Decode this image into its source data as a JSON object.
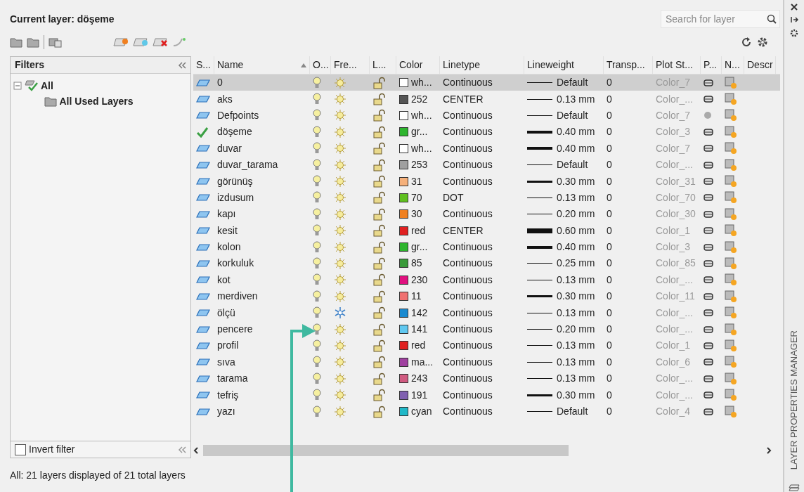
{
  "header": {
    "title": "Current layer: döşeme",
    "search": {
      "placeholder": "Search for layer"
    }
  },
  "filters": {
    "title": "Filters",
    "tree": [
      {
        "label": "All",
        "expanded": true,
        "children": [
          {
            "label": "All Used Layers"
          }
        ]
      }
    ],
    "invert_filter": {
      "label": "Invert filter",
      "checked": false
    }
  },
  "table": {
    "columns": [
      {
        "label": "S...",
        "sorted": false
      },
      {
        "label": "Name",
        "sorted": true
      },
      {
        "label": "O...",
        "sorted": false
      },
      {
        "label": "Fre...",
        "sorted": false
      },
      {
        "label": "L...",
        "sorted": false
      },
      {
        "label": "Color",
        "sorted": false
      },
      {
        "label": "Linetype",
        "sorted": false
      },
      {
        "label": "Lineweight",
        "sorted": false
      },
      {
        "label": "Transp...",
        "sorted": false
      },
      {
        "label": "Plot St...",
        "sorted": false
      },
      {
        "label": "P...",
        "sorted": false
      },
      {
        "label": "N...",
        "sorted": false
      },
      {
        "label": "Descr",
        "sorted": false
      }
    ],
    "rows": [
      {
        "kind": "layer",
        "name": "0",
        "on": true,
        "frozen": false,
        "locked": false,
        "color": "#ffffff",
        "color_label": "wh...",
        "linetype": "Continuous",
        "lineweight": {
          "kind": "thin",
          "text": "Default"
        },
        "transparency": "0",
        "plot_style": "Color_7",
        "plot": true,
        "selected": true
      },
      {
        "kind": "layer",
        "name": "aks",
        "on": true,
        "frozen": false,
        "locked": false,
        "color": "#555555",
        "color_label": "252",
        "linetype": "CENTER",
        "lineweight": {
          "kind": "thin",
          "text": "0.13 mm"
        },
        "transparency": "0",
        "plot_style": "Color_...",
        "plot": true,
        "selected": false
      },
      {
        "kind": "layer",
        "name": "Defpoints",
        "on": true,
        "frozen": false,
        "locked": false,
        "color": "#ffffff",
        "color_label": "wh...",
        "linetype": "Continuous",
        "lineweight": {
          "kind": "thin",
          "text": "Default"
        },
        "transparency": "0",
        "plot_style": "Color_7",
        "plot": false,
        "selected": false
      },
      {
        "kind": "current",
        "name": "döşeme",
        "on": true,
        "frozen": false,
        "locked": false,
        "color": "#2eb52e",
        "color_label": "gr...",
        "linetype": "Continuous",
        "lineweight": {
          "kind": "thick",
          "text": "0.40 mm"
        },
        "transparency": "0",
        "plot_style": "Color_3",
        "plot": true,
        "selected": false
      },
      {
        "kind": "layer",
        "name": "duvar",
        "on": true,
        "frozen": false,
        "locked": false,
        "color": "#ffffff",
        "color_label": "wh...",
        "linetype": "Continuous",
        "lineweight": {
          "kind": "thick",
          "text": "0.40 mm"
        },
        "transparency": "0",
        "plot_style": "Color_7",
        "plot": true,
        "selected": false
      },
      {
        "kind": "layer",
        "name": "duvar_tarama",
        "on": true,
        "frozen": false,
        "locked": false,
        "color": "#a0a0a0",
        "color_label": "253",
        "linetype": "Continuous",
        "lineweight": {
          "kind": "thin",
          "text": "Default"
        },
        "transparency": "0",
        "plot_style": "Color_...",
        "plot": true,
        "selected": false
      },
      {
        "kind": "layer",
        "name": "görünüş",
        "on": true,
        "frozen": false,
        "locked": false,
        "color": "#f5b07a",
        "color_label": "31",
        "linetype": "Continuous",
        "lineweight": {
          "kind": "medium",
          "text": "0.30 mm"
        },
        "transparency": "0",
        "plot_style": "Color_31",
        "plot": true,
        "selected": false
      },
      {
        "kind": "layer",
        "name": "izdusum",
        "on": true,
        "frozen": false,
        "locked": false,
        "color": "#5fbf1f",
        "color_label": "70",
        "linetype": "DOT",
        "lineweight": {
          "kind": "thin",
          "text": "0.13 mm"
        },
        "transparency": "0",
        "plot_style": "Color_70",
        "plot": true,
        "selected": false
      },
      {
        "kind": "layer",
        "name": "kapı",
        "on": true,
        "frozen": false,
        "locked": false,
        "color": "#f08020",
        "color_label": "30",
        "linetype": "Continuous",
        "lineweight": {
          "kind": "thin",
          "text": "0.20 mm"
        },
        "transparency": "0",
        "plot_style": "Color_30",
        "plot": true,
        "selected": false
      },
      {
        "kind": "layer",
        "name": "kesit",
        "on": true,
        "frozen": false,
        "locked": false,
        "color": "#e02020",
        "color_label": "red",
        "linetype": "CENTER",
        "lineweight": {
          "kind": "heavy",
          "text": "0.60 mm"
        },
        "transparency": "0",
        "plot_style": "Color_1",
        "plot": true,
        "selected": false
      },
      {
        "kind": "layer",
        "name": "kolon",
        "on": true,
        "frozen": false,
        "locked": false,
        "color": "#2eb52e",
        "color_label": "gr...",
        "linetype": "Continuous",
        "lineweight": {
          "kind": "thick",
          "text": "0.40 mm"
        },
        "transparency": "0",
        "plot_style": "Color_3",
        "plot": true,
        "selected": false
      },
      {
        "kind": "layer",
        "name": "korkuluk",
        "on": true,
        "frozen": false,
        "locked": false,
        "color": "#3a9a3a",
        "color_label": "85",
        "linetype": "Continuous",
        "lineweight": {
          "kind": "thin",
          "text": "0.25 mm"
        },
        "transparency": "0",
        "plot_style": "Color_85",
        "plot": true,
        "selected": false
      },
      {
        "kind": "layer",
        "name": "kot",
        "on": true,
        "frozen": false,
        "locked": false,
        "color": "#e0107f",
        "color_label": "230",
        "linetype": "Continuous",
        "lineweight": {
          "kind": "thin",
          "text": "0.13 mm"
        },
        "transparency": "0",
        "plot_style": "Color_...",
        "plot": true,
        "selected": false
      },
      {
        "kind": "layer",
        "name": "merdiven",
        "on": true,
        "frozen": false,
        "locked": false,
        "color": "#f07070",
        "color_label": "11",
        "linetype": "Continuous",
        "lineweight": {
          "kind": "medium",
          "text": "0.30 mm"
        },
        "transparency": "0",
        "plot_style": "Color_11",
        "plot": true,
        "selected": false
      },
      {
        "kind": "layer",
        "name": "ölçü",
        "on": true,
        "frozen": true,
        "locked": false,
        "color": "#1a8ad0",
        "color_label": "142",
        "linetype": "Continuous",
        "lineweight": {
          "kind": "thin",
          "text": "0.13 mm"
        },
        "transparency": "0",
        "plot_style": "Color_...",
        "plot": true,
        "selected": false
      },
      {
        "kind": "layer",
        "name": "pencere",
        "on": true,
        "frozen": false,
        "locked": false,
        "color": "#60c8f0",
        "color_label": "141",
        "linetype": "Continuous",
        "lineweight": {
          "kind": "thin",
          "text": "0.20 mm"
        },
        "transparency": "0",
        "plot_style": "Color_...",
        "plot": true,
        "selected": false
      },
      {
        "kind": "layer",
        "name": "profil",
        "on": true,
        "frozen": false,
        "locked": false,
        "color": "#e02020",
        "color_label": "red",
        "linetype": "Continuous",
        "lineweight": {
          "kind": "thin",
          "text": "0.13 mm"
        },
        "transparency": "0",
        "plot_style": "Color_1",
        "plot": true,
        "selected": false
      },
      {
        "kind": "layer",
        "name": "sıva",
        "on": true,
        "frozen": false,
        "locked": false,
        "color": "#a040a0",
        "color_label": "ma...",
        "linetype": "Continuous",
        "lineweight": {
          "kind": "thin",
          "text": "0.13 mm"
        },
        "transparency": "0",
        "plot_style": "Color_6",
        "plot": true,
        "selected": false
      },
      {
        "kind": "layer",
        "name": "tarama",
        "on": true,
        "frozen": false,
        "locked": false,
        "color": "#d05a80",
        "color_label": "243",
        "linetype": "Continuous",
        "lineweight": {
          "kind": "thin",
          "text": "0.13 mm"
        },
        "transparency": "0",
        "plot_style": "Color_...",
        "plot": true,
        "selected": false
      },
      {
        "kind": "layer",
        "name": "tefriş",
        "on": true,
        "frozen": false,
        "locked": false,
        "color": "#8060b0",
        "color_label": "191",
        "linetype": "Continuous",
        "lineweight": {
          "kind": "medium",
          "text": "0.30 mm"
        },
        "transparency": "0",
        "plot_style": "Color_...",
        "plot": true,
        "selected": false
      },
      {
        "kind": "layer",
        "name": "yazı",
        "on": true,
        "frozen": false,
        "locked": false,
        "color": "#20b8c8",
        "color_label": "cyan",
        "linetype": "Continuous",
        "lineweight": {
          "kind": "thin",
          "text": "Default"
        },
        "transparency": "0",
        "plot_style": "Color_4",
        "plot": true,
        "selected": false
      }
    ]
  },
  "status_bar": "All: 21 layers displayed of 21 total layers",
  "side_panel": {
    "title": "LAYER PROPERTIES MANAGER"
  }
}
